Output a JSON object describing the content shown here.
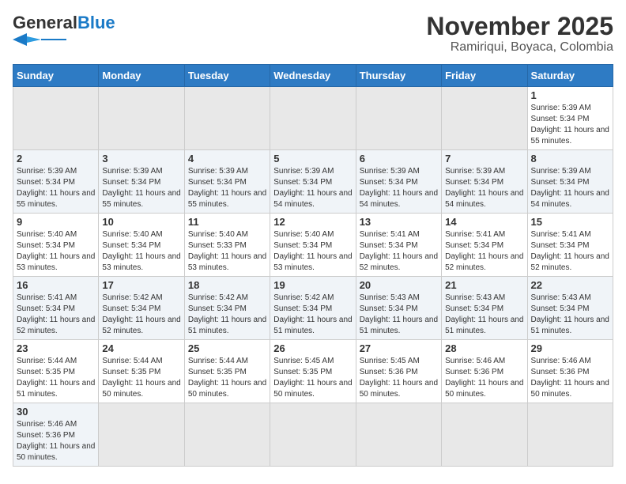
{
  "header": {
    "logo_general": "General",
    "logo_blue": "Blue",
    "month_title": "November 2025",
    "location": "Ramiriqui, Boyaca, Colombia"
  },
  "weekdays": [
    "Sunday",
    "Monday",
    "Tuesday",
    "Wednesday",
    "Thursday",
    "Friday",
    "Saturday"
  ],
  "days": [
    {
      "num": "",
      "empty": true
    },
    {
      "num": "",
      "empty": true
    },
    {
      "num": "",
      "empty": true
    },
    {
      "num": "",
      "empty": true
    },
    {
      "num": "",
      "empty": true
    },
    {
      "num": "",
      "empty": true
    },
    {
      "num": "1",
      "sunrise": "5:39 AM",
      "sunset": "5:34 PM",
      "daylight": "11 hours and 55 minutes."
    },
    {
      "num": "2",
      "sunrise": "5:39 AM",
      "sunset": "5:34 PM",
      "daylight": "11 hours and 55 minutes."
    },
    {
      "num": "3",
      "sunrise": "5:39 AM",
      "sunset": "5:34 PM",
      "daylight": "11 hours and 55 minutes."
    },
    {
      "num": "4",
      "sunrise": "5:39 AM",
      "sunset": "5:34 PM",
      "daylight": "11 hours and 55 minutes."
    },
    {
      "num": "5",
      "sunrise": "5:39 AM",
      "sunset": "5:34 PM",
      "daylight": "11 hours and 54 minutes."
    },
    {
      "num": "6",
      "sunrise": "5:39 AM",
      "sunset": "5:34 PM",
      "daylight": "11 hours and 54 minutes."
    },
    {
      "num": "7",
      "sunrise": "5:39 AM",
      "sunset": "5:34 PM",
      "daylight": "11 hours and 54 minutes."
    },
    {
      "num": "8",
      "sunrise": "5:39 AM",
      "sunset": "5:34 PM",
      "daylight": "11 hours and 54 minutes."
    },
    {
      "num": "9",
      "sunrise": "5:40 AM",
      "sunset": "5:34 PM",
      "daylight": "11 hours and 53 minutes."
    },
    {
      "num": "10",
      "sunrise": "5:40 AM",
      "sunset": "5:34 PM",
      "daylight": "11 hours and 53 minutes."
    },
    {
      "num": "11",
      "sunrise": "5:40 AM",
      "sunset": "5:33 PM",
      "daylight": "11 hours and 53 minutes."
    },
    {
      "num": "12",
      "sunrise": "5:40 AM",
      "sunset": "5:34 PM",
      "daylight": "11 hours and 53 minutes."
    },
    {
      "num": "13",
      "sunrise": "5:41 AM",
      "sunset": "5:34 PM",
      "daylight": "11 hours and 52 minutes."
    },
    {
      "num": "14",
      "sunrise": "5:41 AM",
      "sunset": "5:34 PM",
      "daylight": "11 hours and 52 minutes."
    },
    {
      "num": "15",
      "sunrise": "5:41 AM",
      "sunset": "5:34 PM",
      "daylight": "11 hours and 52 minutes."
    },
    {
      "num": "16",
      "sunrise": "5:41 AM",
      "sunset": "5:34 PM",
      "daylight": "11 hours and 52 minutes."
    },
    {
      "num": "17",
      "sunrise": "5:42 AM",
      "sunset": "5:34 PM",
      "daylight": "11 hours and 52 minutes."
    },
    {
      "num": "18",
      "sunrise": "5:42 AM",
      "sunset": "5:34 PM",
      "daylight": "11 hours and 51 minutes."
    },
    {
      "num": "19",
      "sunrise": "5:42 AM",
      "sunset": "5:34 PM",
      "daylight": "11 hours and 51 minutes."
    },
    {
      "num": "20",
      "sunrise": "5:43 AM",
      "sunset": "5:34 PM",
      "daylight": "11 hours and 51 minutes."
    },
    {
      "num": "21",
      "sunrise": "5:43 AM",
      "sunset": "5:34 PM",
      "daylight": "11 hours and 51 minutes."
    },
    {
      "num": "22",
      "sunrise": "5:43 AM",
      "sunset": "5:34 PM",
      "daylight": "11 hours and 51 minutes."
    },
    {
      "num": "23",
      "sunrise": "5:44 AM",
      "sunset": "5:35 PM",
      "daylight": "11 hours and 51 minutes."
    },
    {
      "num": "24",
      "sunrise": "5:44 AM",
      "sunset": "5:35 PM",
      "daylight": "11 hours and 50 minutes."
    },
    {
      "num": "25",
      "sunrise": "5:44 AM",
      "sunset": "5:35 PM",
      "daylight": "11 hours and 50 minutes."
    },
    {
      "num": "26",
      "sunrise": "5:45 AM",
      "sunset": "5:35 PM",
      "daylight": "11 hours and 50 minutes."
    },
    {
      "num": "27",
      "sunrise": "5:45 AM",
      "sunset": "5:36 PM",
      "daylight": "11 hours and 50 minutes."
    },
    {
      "num": "28",
      "sunrise": "5:46 AM",
      "sunset": "5:36 PM",
      "daylight": "11 hours and 50 minutes."
    },
    {
      "num": "29",
      "sunrise": "5:46 AM",
      "sunset": "5:36 PM",
      "daylight": "11 hours and 50 minutes."
    },
    {
      "num": "30",
      "sunrise": "5:46 AM",
      "sunset": "5:36 PM",
      "daylight": "11 hours and 50 minutes."
    },
    {
      "num": "",
      "empty": true
    },
    {
      "num": "",
      "empty": true
    },
    {
      "num": "",
      "empty": true
    },
    {
      "num": "",
      "empty": true
    },
    {
      "num": "",
      "empty": true
    },
    {
      "num": "",
      "empty": true
    }
  ],
  "labels": {
    "sunrise": "Sunrise:",
    "sunset": "Sunset:",
    "daylight": "Daylight:"
  }
}
